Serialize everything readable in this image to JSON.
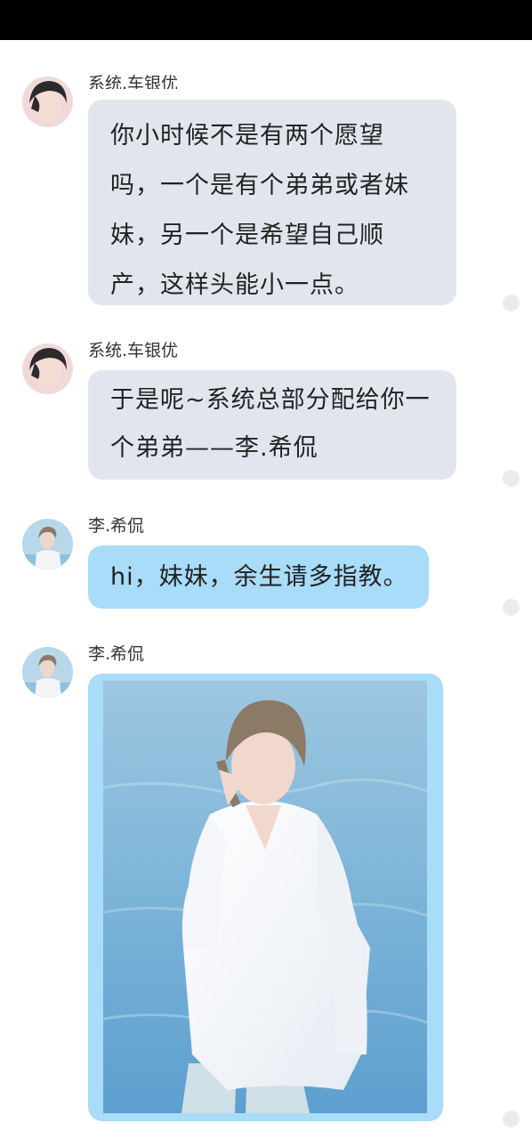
{
  "messages": [
    {
      "sender": "系统.车银优",
      "lines": [
        "你小时候不是有两个愿望",
        "吗，一个是有个弟弟或者妹",
        "妹，另一个是希望自己顺",
        "产，这样头能小一点。"
      ]
    },
    {
      "sender": "系统.车银优",
      "lines": [
        "于是呢~系统总部分配给你一",
        "个弟弟——李.希侃"
      ]
    },
    {
      "sender": "李.希侃",
      "lines": [
        "hi，妹妹，余生请多指教。"
      ]
    },
    {
      "sender": "李.希侃",
      "image": "photo-of-person-in-white-shirt-by-water"
    }
  ],
  "colors": {
    "status_bar": "#000000",
    "bubble_system": "#e1e6ee",
    "bubble_character": "#a8dcf8",
    "read_dot": "#ebebeb"
  }
}
